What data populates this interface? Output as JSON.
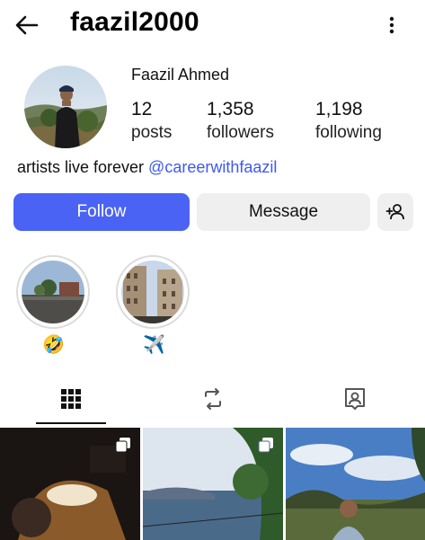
{
  "header": {
    "username": "faazil2000",
    "back_icon": "arrow-left-icon",
    "more_icon": "vertical-dots-icon"
  },
  "profile": {
    "full_name": "Faazil Ahmed",
    "stats": [
      {
        "number": "12",
        "label": "posts"
      },
      {
        "number": "1,358",
        "label": "followers"
      },
      {
        "number": "1,198",
        "label": "following"
      }
    ],
    "bio_text": "artists live forever ",
    "bio_mention": "@careerwithfaazil"
  },
  "actions": {
    "follow_label": "Follow",
    "message_label": "Message",
    "add_user_icon": "add-user-icon"
  },
  "highlights": [
    {
      "emoji": "🤣"
    },
    {
      "emoji": "✈️"
    }
  ],
  "tabs": [
    {
      "icon": "grid-icon",
      "active": true
    },
    {
      "icon": "reels-icon",
      "active": false
    },
    {
      "icon": "tagged-icon",
      "active": false
    }
  ],
  "colors": {
    "follow_button": "#4a63f5",
    "mention": "#3d5af1",
    "secondary_button": "#efefef"
  }
}
